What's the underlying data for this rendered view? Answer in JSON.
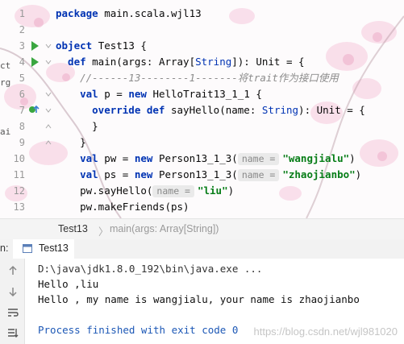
{
  "left_strip": [
    "ct",
    "rg",
    "ai"
  ],
  "editor": {
    "lines": [
      {
        "num": "1",
        "tokens": [
          {
            "t": "package ",
            "c": "kw"
          },
          {
            "t": "main.scala.wjl13",
            "c": ""
          }
        ]
      },
      {
        "num": "2",
        "tokens": []
      },
      {
        "num": "3",
        "tokens": [
          {
            "t": "object ",
            "c": "kw"
          },
          {
            "t": "Test13 {",
            "c": ""
          }
        ],
        "run_icon": true
      },
      {
        "num": "4",
        "tokens": [
          {
            "t": "  def ",
            "c": "kw"
          },
          {
            "t": "main(args: Array[",
            "c": ""
          },
          {
            "t": "String",
            "c": "typ"
          },
          {
            "t": "]): Unit = {",
            "c": ""
          }
        ],
        "run_icon": true
      },
      {
        "num": "5",
        "tokens": [
          {
            "t": "    //------13--------1-------将trait作为接口使用",
            "c": "cmt"
          }
        ]
      },
      {
        "num": "6",
        "tokens": [
          {
            "t": "    val ",
            "c": "kw"
          },
          {
            "t": "p = ",
            "c": ""
          },
          {
            "t": "new ",
            "c": "kw"
          },
          {
            "t": "HelloTrait13_1_1 {",
            "c": ""
          }
        ]
      },
      {
        "num": "7",
        "tokens": [
          {
            "t": "      override def ",
            "c": "kw"
          },
          {
            "t": "sayHello(name: ",
            "c": ""
          },
          {
            "t": "String",
            "c": "typ"
          },
          {
            "t": "): Unit = {",
            "c": ""
          }
        ],
        "override_icon": true
      },
      {
        "num": "8",
        "tokens": [
          {
            "t": "      }",
            "c": ""
          }
        ]
      },
      {
        "num": "9",
        "tokens": [
          {
            "t": "    }",
            "c": ""
          }
        ]
      },
      {
        "num": "10",
        "tokens": [
          {
            "t": "    val ",
            "c": "kw"
          },
          {
            "t": "pw = ",
            "c": ""
          },
          {
            "t": "new ",
            "c": "kw"
          },
          {
            "t": "Person13_1_3(",
            "c": ""
          },
          {
            "hint": "name ="
          },
          {
            "t": "\"wangjialu\"",
            "c": "str"
          },
          {
            "t": ")",
            "c": ""
          }
        ]
      },
      {
        "num": "11",
        "tokens": [
          {
            "t": "    val ",
            "c": "kw"
          },
          {
            "t": "ps = ",
            "c": ""
          },
          {
            "t": "new ",
            "c": "kw"
          },
          {
            "t": "Person13_1_3(",
            "c": ""
          },
          {
            "hint": "name ="
          },
          {
            "t": "\"zhaojianbo\"",
            "c": "str"
          },
          {
            "t": ")",
            "c": ""
          }
        ]
      },
      {
        "num": "12",
        "tokens": [
          {
            "t": "    pw.sayHello(",
            "c": ""
          },
          {
            "hint": "name ="
          },
          {
            "t": "\"liu\"",
            "c": "str"
          },
          {
            "t": ")",
            "c": ""
          }
        ]
      },
      {
        "num": "13",
        "tokens": [
          {
            "t": "    pw.makeFriends(ps)",
            "c": ""
          }
        ]
      }
    ]
  },
  "breadcrumb": {
    "file": "Test13",
    "separator": "〉",
    "method": "main(args: Array[String])"
  },
  "run": {
    "prefix": "n:",
    "tab_label": "Test13",
    "output": [
      {
        "text": "D:\\java\\jdk1.8.0_192\\bin\\java.exe ...",
        "color": "#333333"
      },
      {
        "text": "Hello ,liu",
        "color": "#111111"
      },
      {
        "text": "Hello , my name is wangjialu, your name is zhaojianbo",
        "color": "#111111"
      },
      {
        "text": "",
        "color": "#111111"
      },
      {
        "text": "Process finished with exit code 0",
        "color": "#1d58b6"
      }
    ]
  },
  "watermark": "https://blog.csdn.net/wjl981020",
  "colors": {
    "keyword": "#0033b3",
    "string": "#067d17",
    "comment": "#8c8c8c",
    "run_green": "#3aa640",
    "process_blue": "#1d58b6"
  }
}
